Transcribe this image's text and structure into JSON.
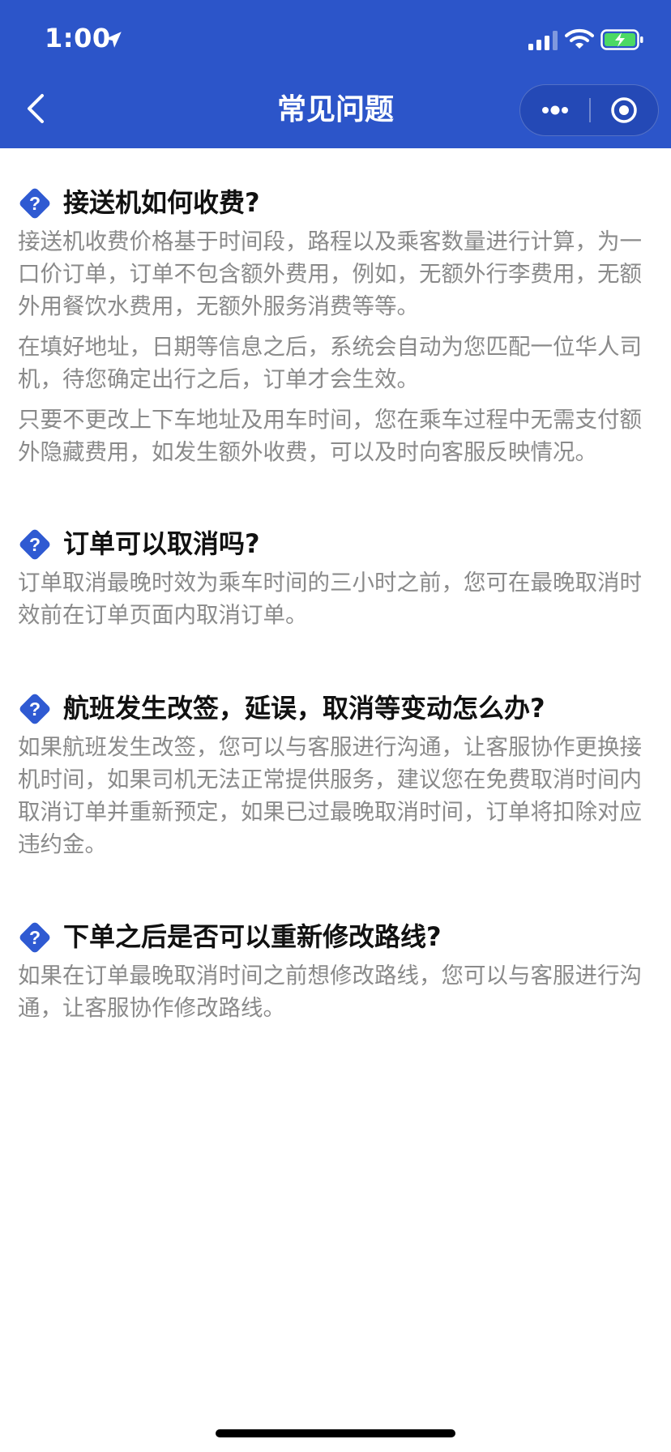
{
  "status_bar": {
    "time": "1:00"
  },
  "nav": {
    "title": "常见问题"
  },
  "faqs": [
    {
      "question": "接送机如何收费?",
      "paragraphs": [
        "接送机收费价格基于时间段，路程以及乘客数量进行计算，为一口价订单，订单不包含额外费用，例如，无额外行李费用，无额外用餐饮水费用，无额外服务消费等等。",
        "在填好地址，日期等信息之后，系统会自动为您匹配一位华人司机，待您确定出行之后，订单才会生效。",
        "只要不更改上下车地址及用车时间，您在乘车过程中无需支付额外隐藏费用，如发生额外收费，可以及时向客服反映情况。"
      ]
    },
    {
      "question": "订单可以取消吗?",
      "paragraphs": [
        "订单取消最晚时效为乘车时间的三小时之前，您可在最晚取消时效前在订单页面内取消订单。"
      ]
    },
    {
      "question": "航班发生改签，延误，取消等变动怎么办?",
      "paragraphs": [
        "如果航班发生改签，您可以与客服进行沟通，让客服协作更换接机时间，如果司机无法正常提供服务，建议您在免费取消时间内取消订单并重新预定，如果已过最晚取消时间，订单将扣除对应违约金。"
      ]
    },
    {
      "question": "下单之后是否可以重新修改路线?",
      "paragraphs": [
        "如果在订单最晚取消时间之前想修改路线，您可以与客服进行沟通，让客服协作修改路线。"
      ]
    }
  ],
  "colors": {
    "header_bg": "#2c55c9",
    "accent_icon": "#2f5ad2",
    "answer_text": "#8a8a8a",
    "question_text": "#111111"
  },
  "icons": {
    "back": "chevron-left-icon",
    "more": "more-dots-icon",
    "close": "target-close-icon",
    "question": "question-diamond-icon"
  }
}
